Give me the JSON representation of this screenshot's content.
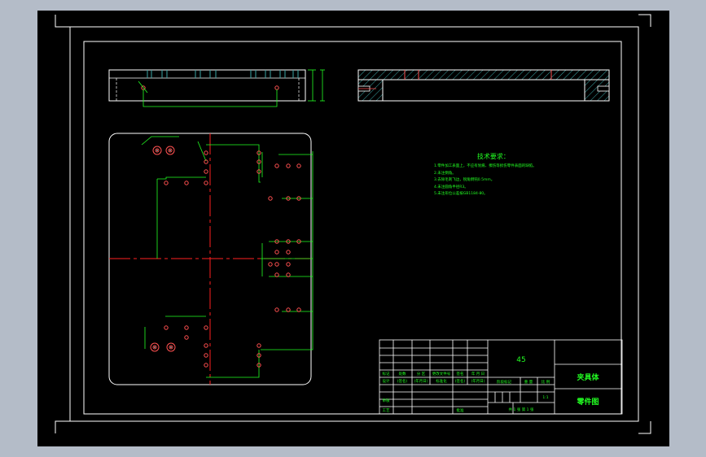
{
  "colors": {
    "background": "#b4bcc8",
    "paper": "#000000",
    "border": "#ffffff",
    "dimension": "#22ff22",
    "centerline": "#ff2020",
    "hatch": "#3aa4a4",
    "hole": "#ff5050",
    "text": "#22ff22"
  },
  "drawing": {
    "icons": [
      "frame-corner-marks",
      "hole-circle",
      "centerline-cross"
    ]
  },
  "notes": {
    "title": "技术要求：",
    "lines": [
      "1.零件加工表面上，不应有划痕、擦伤等损伤零件表面的缺陷。",
      "2.未注倒角。",
      "3.去除毛刺飞边，锐角倒钝0.5mm。",
      "4.未注圆角半径R3。",
      "5.未注形位公差按GB1184-80。"
    ]
  },
  "title_block": {
    "material": "45",
    "part_name": "夹具体",
    "drawing_type": "零件图",
    "header_labels": [
      "标记",
      "处数",
      "分 区",
      "更改文件号",
      "签名",
      "年 月 日"
    ],
    "row_labels": [
      "设计",
      "(签名)",
      "(年月日)",
      "标准化",
      "(签名)",
      "(年月日)"
    ],
    "stage_label": "阶段标记",
    "weight_label": "重 量",
    "scale_label": "比 例",
    "scale_value": "1:1",
    "sheet_text": "共 1 张   第 1 张",
    "review_label": "审核",
    "process_label": "工艺",
    "approve_label": "批准"
  }
}
